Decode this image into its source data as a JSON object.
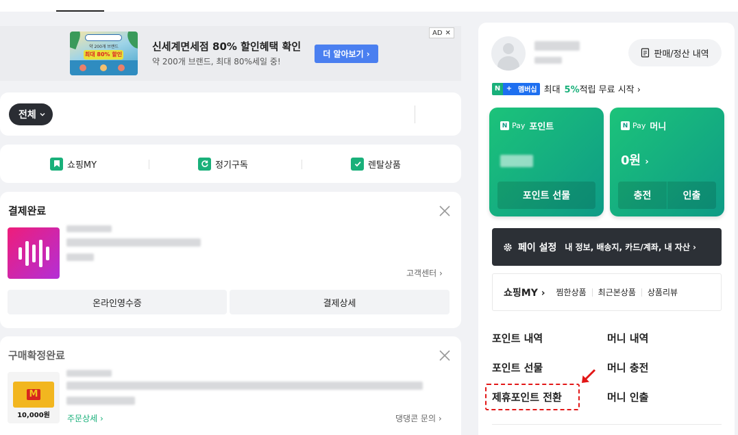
{
  "ad": {
    "thumb_small": "약 200개 브랜드",
    "thumb_big": "최대 80% 할인",
    "title": "신세계면세점 80% 할인혜택 확인",
    "subtitle": "약 200개 브랜드, 최대 80%세일 중!",
    "button": "더 알아보기",
    "badge": "AD"
  },
  "search": {
    "filter": "전체"
  },
  "quick": {
    "items": [
      "쇼핑MY",
      "정기구독",
      "렌탈상품"
    ]
  },
  "order1": {
    "title": "결제완료",
    "link": "고객센터",
    "buttons": [
      "온라인영수증",
      "결제상세"
    ]
  },
  "order2": {
    "title": "구매확정완료",
    "coupon_price": "10,000원",
    "detail": "주문상세",
    "link": "댕댕콘 문의"
  },
  "profile": {
    "sales_button": "판매/정산 내역"
  },
  "membership": {
    "badge": "멤버십",
    "pre": "최대",
    "pct": "5%",
    "post": "적립 무료 시작"
  },
  "point_card": {
    "pay": "Pay",
    "title": "포인트",
    "button": "포인트 선물"
  },
  "money_card": {
    "pay": "Pay",
    "title": "머니",
    "amount": "0원",
    "buttons": [
      "충전",
      "인출"
    ]
  },
  "pay_setting": {
    "title": "페이 설정",
    "desc": "내 정보, 배송지, 카드/계좌, 내 자산"
  },
  "shop_bar": {
    "lead": "쇼핑MY",
    "items": [
      "찜한상품",
      "최근본상품",
      "상품리뷰"
    ]
  },
  "menu": {
    "point_history": "포인트 내역",
    "money_history": "머니 내역",
    "point_gift": "포인트 선물",
    "money_charge": "머니 충전",
    "partner_convert": "제휴포인트 전환",
    "money_withdraw": "머니 인출"
  },
  "colors": {
    "green": "#19b07a",
    "blue": "#4a7ff0",
    "dark": "#2c3036",
    "red": "#e21616"
  }
}
